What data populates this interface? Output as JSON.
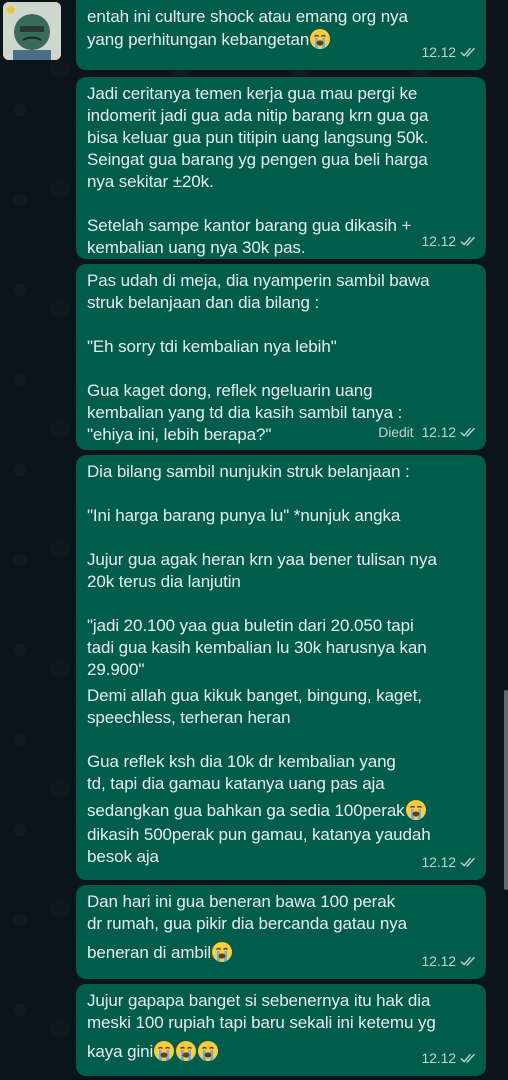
{
  "messages": [
    {
      "id": "m1",
      "lines": [
        "entah ini culture shock atau emang org nya",
        "yang perhitungan kebangetan"
      ],
      "emojis": [
        "crying-face"
      ],
      "time": "12.12",
      "edited": ""
    },
    {
      "id": "m2",
      "paragraphs": [
        "Jadi ceritanya temen kerja gua mau pergi ke\nindomerit jadi gua ada nitip barang krn gua ga\nbisa keluar gua pun titipin uang langsung 50k.\nSeingat gua barang yg pengen gua beli harga\nnya sekitar ±20k.",
        "Setelah sampe kantor barang gua dikasih +\nkembalian uang nya 30k pas."
      ],
      "time": "12.12",
      "edited": ""
    },
    {
      "id": "m3",
      "paragraphs": [
        "Pas udah di meja, dia nyamperin sambil bawa\nstruk belanjaan dan dia bilang :",
        "\"Eh sorry tdi kembalian nya lebih\"",
        "Gua kaget dong, reflek ngeluarin uang\nkembalian yang td dia kasih sambil tanya :\n\"ehiya ini, lebih berapa?\""
      ],
      "time": "12.12",
      "edited": "Diedit"
    },
    {
      "id": "m4",
      "paragraphs": [
        "Dia bilang sambil nunjukin struk belanjaan :",
        "\"Ini harga barang punya lu\" *nunjuk angka",
        "Jujur gua agak heran krn yaa bener tulisan nya\n20k terus dia lanjutin",
        "\"jadi 20.100 yaa gua buletin dari 20.050 tapi\ntadi gua kasih kembalian lu 30k harusnya kan\n29.900\""
      ],
      "para5": "Demi allah gua kikuk banget, bingung, kaget,\nspeechless, terheran heran",
      "para6a": "Gua reflek ksh dia 10k dr kembalian yang\ntd, tapi dia gamau katanya uang pas aja",
      "para6b": "sedangkan gua bahkan ga sedia 100perak",
      "para6c": "dikasih 500perak pun gamau, katanya yaudah\nbesok aja",
      "time": "12.12",
      "edited": ""
    },
    {
      "id": "m5",
      "line1": "Dan hari ini gua beneran bawa 100 perak\ndr rumah, gua pikir dia bercanda gatau nya",
      "line2": "beneran di ambil",
      "time": "12.12",
      "edited": ""
    },
    {
      "id": "m6",
      "line1": "Jujur gapapa banget si sebenernya itu hak dia\nmeski 100 rupiah tapi baru sekali ini ketemu yg",
      "line2": "kaya gini",
      "time": "12.12",
      "edited": ""
    }
  ],
  "colors": {
    "background": "#0b141a",
    "bubble_outgoing": "#005c4b",
    "text": "#e9edef",
    "meta": "#c3d2cd"
  },
  "icons": [
    "crying-face",
    "double-check"
  ]
}
